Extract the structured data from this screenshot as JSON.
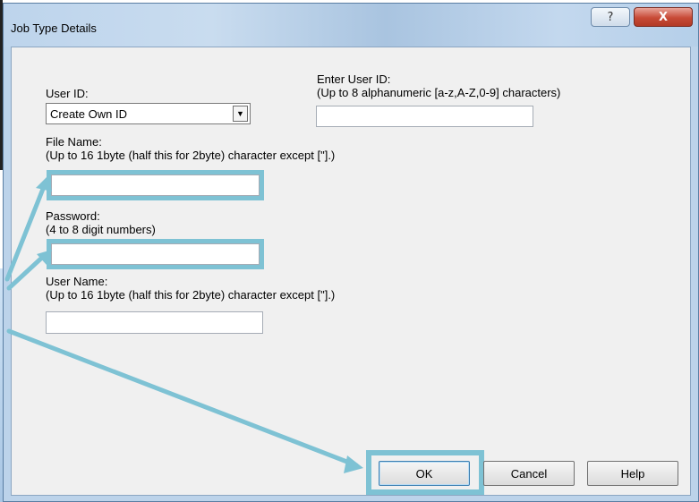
{
  "dialog": {
    "title": "Job Type Details",
    "help_glyph": "?",
    "close_glyph": "X"
  },
  "user_id": {
    "label": "User ID:",
    "selected": "Create Own ID"
  },
  "enter_user_id": {
    "label": "Enter User ID:",
    "hint": "(Up to 8 alphanumeric [a-z,A-Z,0-9] characters)",
    "value": ""
  },
  "file_name": {
    "label": "File Name:",
    "hint": "(Up to 16 1byte (half this for 2byte) character except [\"].)",
    "value": ""
  },
  "password": {
    "label": "Password:",
    "hint": "(4 to 8 digit numbers)",
    "value": ""
  },
  "user_name": {
    "label": "User Name:",
    "hint": "(Up to 16 1byte (half this for 2byte) character except [\"].)",
    "value": ""
  },
  "buttons": {
    "ok": "OK",
    "cancel": "Cancel",
    "help": "Help"
  },
  "colors": {
    "highlight": "#7ec2d4",
    "client_bg": "#f0f0f0"
  }
}
